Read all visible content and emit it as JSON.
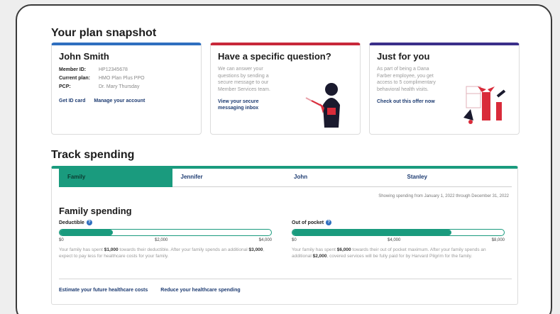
{
  "snapshot": {
    "title": "Your plan snapshot",
    "member_card": {
      "name": "John Smith",
      "rows": [
        {
          "label": "Member ID:",
          "value": "HP12345678"
        },
        {
          "label": "Current plan:",
          "value": "HMO Plan Plus PPO"
        },
        {
          "label": "PCP:",
          "value": "Dr. Mary Thursday"
        }
      ],
      "link_id_card": "Get ID card",
      "link_account": "Manage your account"
    },
    "question_card": {
      "title": "Have a specific question?",
      "body": "We can answer your questions by sending a secure message to our Member Services team.",
      "link": "View your secure messaging inbox"
    },
    "offer_card": {
      "title": "Just for you",
      "body": "As part of being a Dana Farber employee, you get access to 5 complimentary behavioral health visits.",
      "link": "Check out this offer now"
    },
    "colors": {
      "member_accent": "#2f6fbf",
      "question_accent": "#c8283a",
      "offer_accent": "#3b2f8a"
    }
  },
  "spending": {
    "title": "Track spending",
    "tabs": [
      "Family",
      "Jennifer",
      "John",
      "Stanley"
    ],
    "range_note": "Showing spending from January 1, 2022 through December 31, 2022",
    "panel_title": "Family spending",
    "deductible": {
      "label": "Deductible",
      "fill_fraction": 0.25,
      "ticks": [
        "$0",
        "$2,000",
        "$4,000"
      ],
      "desc_pre": "Your family has spent ",
      "spent": "$1,000",
      "desc_mid": " towards their deductible. After your family spends an additional ",
      "remaining": "$3,000",
      "desc_post": ", expect to pay less for healthcare costs for your family."
    },
    "oop": {
      "label": "Out of pocket",
      "fill_fraction": 0.75,
      "ticks": [
        "$0",
        "$4,000",
        "$8,000"
      ],
      "desc_pre": "Your family has spent ",
      "spent": "$6,000",
      "desc_mid": " towards their out of pocket maximum. After your family spends an additional ",
      "remaining": "$2,000",
      "desc_post": ", covered services will be fully paid for by Harvard Pilgrim for the family."
    },
    "link_estimate": "Estimate your future healthcare costs",
    "link_reduce": "Reduce your healthcare spending",
    "colors": {
      "accent": "#1a9b7e"
    }
  }
}
